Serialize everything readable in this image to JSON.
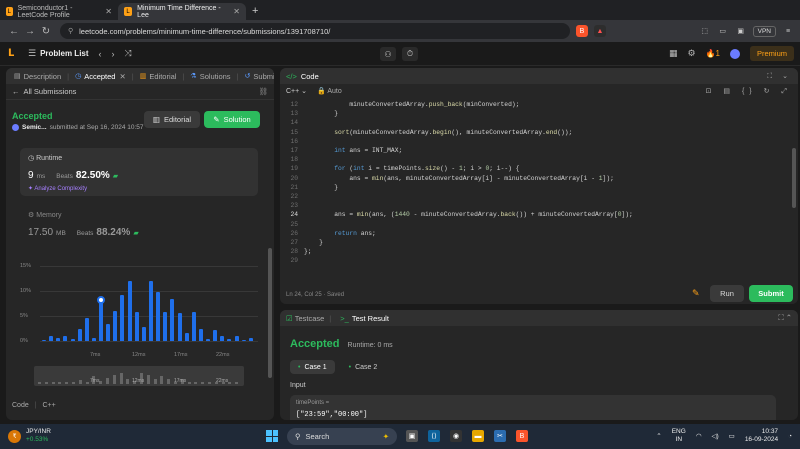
{
  "browser": {
    "tabs": [
      {
        "title": "Semiconductor1 - LeetCode Profile",
        "active": false
      },
      {
        "title": "Minimum Time Difference - Lee",
        "active": true
      }
    ],
    "url": "leetcode.com/problems/minimum-time-difference/submissions/1391708710/",
    "vpn": "VPN"
  },
  "nav": {
    "problem_list": "Problem List",
    "streak": "1",
    "premium": "Premium"
  },
  "left_tabs": [
    "Description",
    "Accepted",
    "Editorial",
    "Solutions",
    "Submission"
  ],
  "all_submissions": "All Submissions",
  "submission": {
    "status": "Accepted",
    "user": "Semic...",
    "submitted": "submitted at Sep 16, 2024 10:57",
    "editorial_btn": "Editorial",
    "solution_btn": "Solution"
  },
  "runtime": {
    "title": "Runtime",
    "value": "9",
    "unit": "ms",
    "beats_label": "Beats",
    "beats": "82.50%",
    "analyze": "Analyze Complexity"
  },
  "memory": {
    "title": "Memory",
    "value": "17.50",
    "unit": "MB",
    "beats_label": "Beats",
    "beats": "88.24%"
  },
  "chart_data": {
    "type": "bar",
    "y_ticks": [
      "15%",
      "10%",
      "5%",
      "0%"
    ],
    "ylim": [
      0,
      15
    ],
    "x_ticks": [
      "7ms",
      "12ms",
      "17ms",
      "22ms"
    ],
    "values": [
      0.3,
      1.0,
      0.6,
      1.1,
      0.5,
      2.4,
      4.6,
      0.6,
      8.1,
      3.5,
      6.0,
      9.2,
      12.1,
      5.9,
      2.8,
      12.0,
      9.9,
      5.9,
      8.5,
      5.6,
      1.7,
      5.8,
      2.4,
      0.5,
      2.2,
      1.0,
      0.5,
      1.0,
      0.3,
      0.6
    ]
  },
  "mini_ticks": [
    "7ms",
    "12ms",
    "17ms",
    "22ms"
  ],
  "code_lang_footer": {
    "code": "Code",
    "lang": "C++"
  },
  "code_panel": {
    "title": "Code",
    "lang": "C++",
    "auto": "Auto",
    "status": "Ln 24, Col 25  ·  Saved",
    "lines": [
      {
        "n": "12",
        "t": "            minuteConvertedArray.push_back(minConverted);"
      },
      {
        "n": "13",
        "t": "        }"
      },
      {
        "n": "14",
        "t": ""
      },
      {
        "n": "15",
        "t": "        sort(minuteConvertedArray.begin(), minuteConvertedArray.end());"
      },
      {
        "n": "16",
        "t": ""
      },
      {
        "n": "17",
        "t": "        int ans = INT_MAX;"
      },
      {
        "n": "18",
        "t": ""
      },
      {
        "n": "19",
        "t": "        for (int i = timePoints.size() - 1; i > 0; i--) {"
      },
      {
        "n": "20",
        "t": "            ans = min(ans, minuteConvertedArray[i] - minuteConvertedArray[i - 1]);"
      },
      {
        "n": "21",
        "t": "        }"
      },
      {
        "n": "22",
        "t": ""
      },
      {
        "n": "23",
        "t": ""
      },
      {
        "n": "24",
        "t": "        ans = min(ans, (1440 - minuteConvertedArray.back()) + minuteConvertedArray[0]);"
      },
      {
        "n": "25",
        "t": ""
      },
      {
        "n": "26",
        "t": "        return ans;"
      },
      {
        "n": "27",
        "t": "    }"
      },
      {
        "n": "28",
        "t": "};"
      },
      {
        "n": "29",
        "t": ""
      }
    ],
    "run": "Run",
    "submit": "Submit"
  },
  "test": {
    "testcase_tab": "Testcase",
    "result_tab": "Test Result",
    "status": "Accepted",
    "runtime": "Runtime: 0 ms",
    "cases": [
      "Case 1",
      "Case 2"
    ],
    "input_label": "Input",
    "var_name": "timePoints =",
    "var_value": "[\"23:59\",\"00:00\"]"
  },
  "taskbar": {
    "stock_name": "JPY/INR",
    "stock_change": "+0.53%",
    "search": "Search",
    "lang1": "ENG",
    "lang2": "IN",
    "time": "10:37",
    "date": "16-09-2024"
  },
  "colors": {
    "accent_green": "#2cbb5d",
    "accent_orange": "#ffa116",
    "bar_blue": "#1f6feb"
  }
}
